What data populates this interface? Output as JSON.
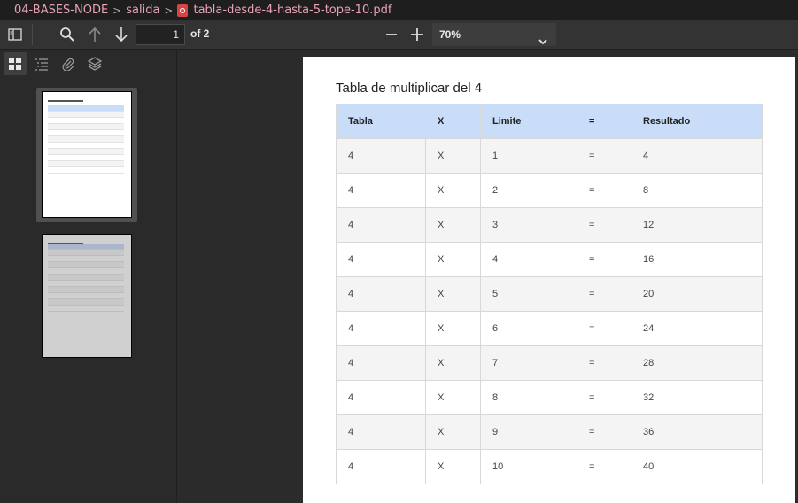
{
  "breadcrumb": {
    "items": [
      "04-BASES-NODE",
      "salida"
    ],
    "file": "tabla-desde-4-hasta-5-tope-10.pdf"
  },
  "toolbar": {
    "page_value": "1",
    "of_pages": "of 2",
    "zoom": "70%"
  },
  "sidebar": {
    "tabs": [
      "thumbnails",
      "outline",
      "attachments",
      "layers"
    ]
  },
  "document": {
    "title": "Tabla de multiplicar del 4",
    "headers": [
      "Tabla",
      "X",
      "Limite",
      "=",
      "Resultado"
    ],
    "rows": [
      [
        "4",
        "X",
        "1",
        "=",
        "4"
      ],
      [
        "4",
        "X",
        "2",
        "=",
        "8"
      ],
      [
        "4",
        "X",
        "3",
        "=",
        "12"
      ],
      [
        "4",
        "X",
        "4",
        "=",
        "16"
      ],
      [
        "4",
        "X",
        "5",
        "=",
        "20"
      ],
      [
        "4",
        "X",
        "6",
        "=",
        "24"
      ],
      [
        "4",
        "X",
        "7",
        "=",
        "28"
      ],
      [
        "4",
        "X",
        "8",
        "=",
        "32"
      ],
      [
        "4",
        "X",
        "9",
        "=",
        "36"
      ],
      [
        "4",
        "X",
        "10",
        "=",
        "40"
      ]
    ]
  },
  "colors": {
    "breadcrumb_text": "#e8a3b4",
    "header_fill": "#c9dcf8",
    "row_alt": "#f4f4f4"
  }
}
